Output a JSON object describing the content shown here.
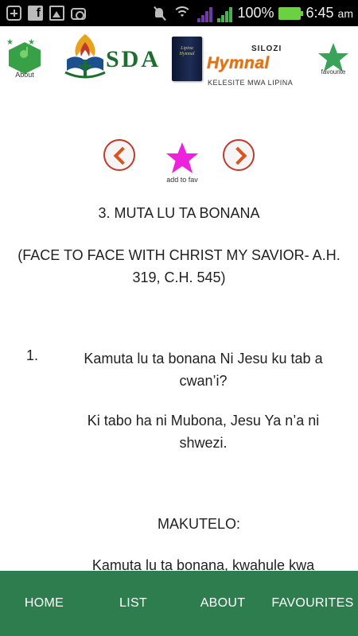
{
  "status_bar": {
    "battery_text": "100%",
    "time": "6:45",
    "ampm": "am",
    "colors": {
      "background": "#000000",
      "signal_bars": "#6e3aa6",
      "battery": "#6dd043"
    }
  },
  "header": {
    "about_label": "About",
    "sda_text": "SDA",
    "book_cover_text": "Lipina Hymnal",
    "silozi_text": "SILOZI",
    "hymnal_text": "Hymnal",
    "subtitle": "KELESITE MWA LIPINA",
    "favourite_label": "favourite"
  },
  "hymn_nav": {
    "add_fav_label": "add to fav",
    "prev_icon": "chevron-left-icon",
    "next_icon": "chevron-right-icon",
    "fav_star_color": "#ee22dd"
  },
  "hymn": {
    "title": "3. MUTA LU TA BONANA",
    "subtitle": "(FACE TO FACE WITH CHRIST MY SAVIOR- A.H. 319, C.H. 545)",
    "verse_number": "1.",
    "verse_line1": "Kamuta lu ta bonana Ni Jesu ku tab a cwan’i?",
    "verse_line2": "Ki tabo ha ni Mubona, Jesu Ya n’a ni shwezi.",
    "chorus_label": "MAKUTELO:",
    "chorus_line": "Kamuta lu ta bonana, kwahule kwa"
  },
  "bottom_nav": {
    "items": [
      "HOME",
      "LIST",
      "ABOUT",
      "FAVOURITES"
    ],
    "background": "#2e7d4f"
  }
}
